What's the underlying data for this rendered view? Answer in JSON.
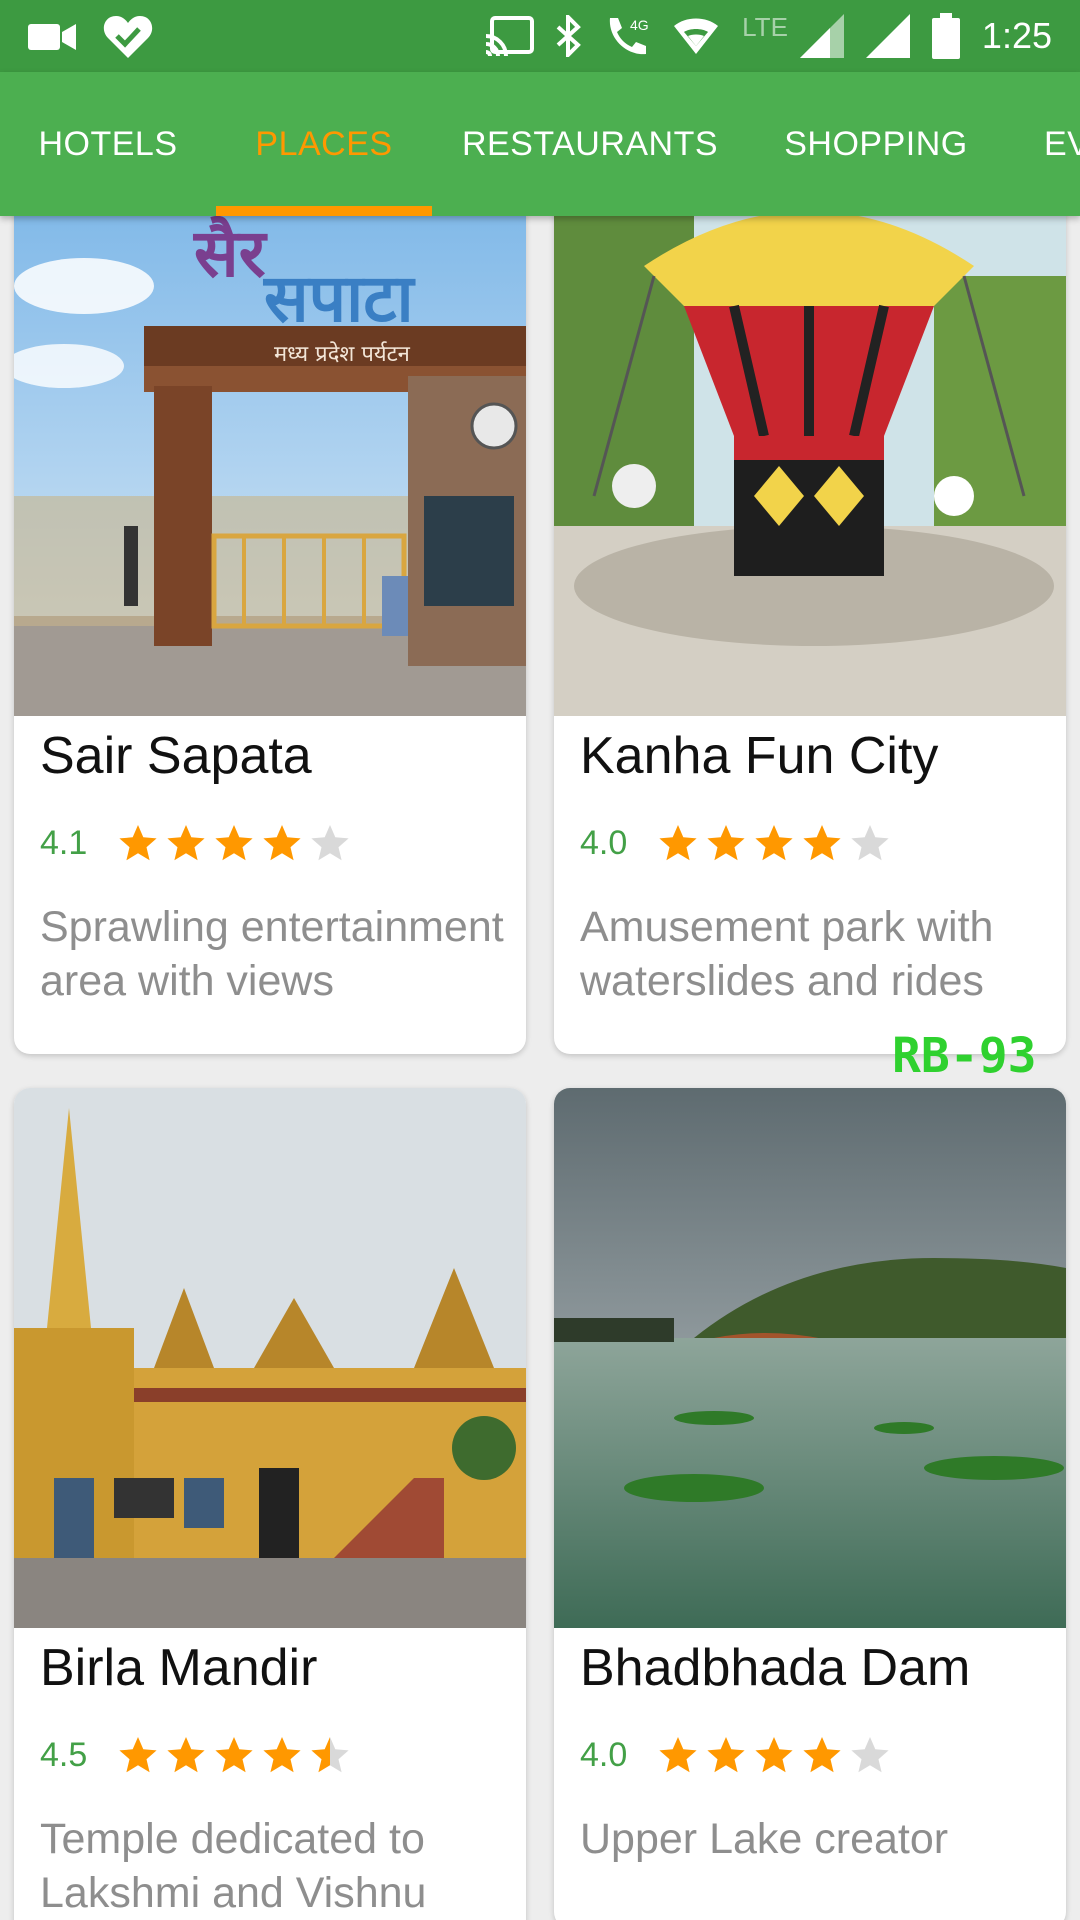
{
  "status_bar": {
    "time": "1:25",
    "network_label": "LTE",
    "icons": [
      "video-camera-icon",
      "heart-check-icon",
      "cast-icon",
      "bluetooth-icon",
      "wifi-call-icon",
      "wifi-icon",
      "signal-icon",
      "signal-icon",
      "battery-icon"
    ]
  },
  "tabs": [
    {
      "label": "HOTELS",
      "active": false
    },
    {
      "label": "PLACES",
      "active": true
    },
    {
      "label": "RESTAURANTS",
      "active": false
    },
    {
      "label": "SHOPPING",
      "active": false
    },
    {
      "label": "EV",
      "active": false
    }
  ],
  "colors": {
    "app_bar": "#4caf50",
    "status_bar": "#3d9a41",
    "accent": "#ff9800",
    "rating_text": "#43a047",
    "star_filled": "#ff9800",
    "star_empty": "#d9d9d9"
  },
  "places": [
    {
      "name": "Sair Sapata",
      "rating": "4.1",
      "stars": 4.0,
      "description": "Sprawling entertainment area with views"
    },
    {
      "name": "Kanha Fun City",
      "rating": "4.0",
      "stars": 4.0,
      "description": "Amusement park with waterslides and rides"
    },
    {
      "name": "Birla Mandir",
      "rating": "4.5",
      "stars": 4.5,
      "description": "Temple dedicated to Lakshmi and Vishnu"
    },
    {
      "name": "Bhadbhada Dam",
      "rating": "4.0",
      "stars": 4.0,
      "description": "Upper Lake creator"
    }
  ],
  "watermark": "RB-93"
}
